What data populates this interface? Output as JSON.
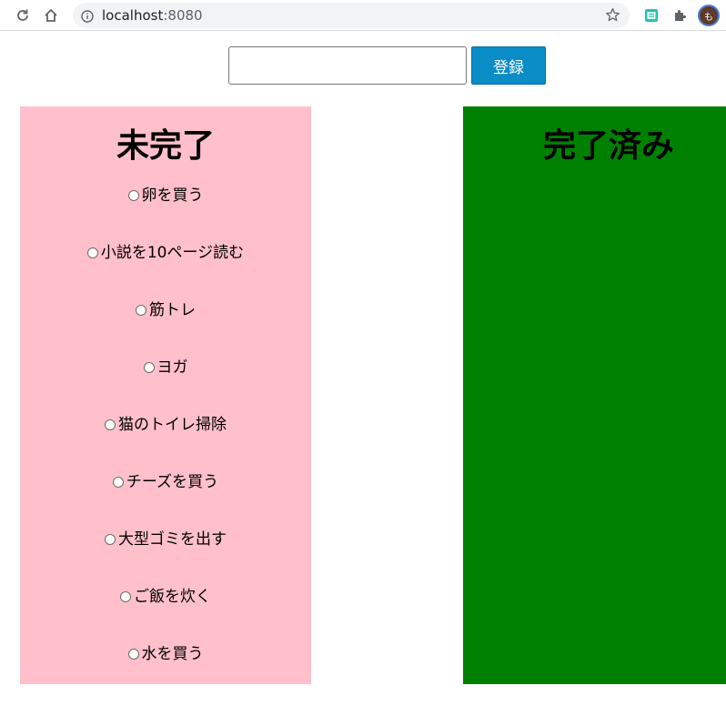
{
  "browser": {
    "url_host": "localhost",
    "url_port": ":8080",
    "avatar_initial": "も"
  },
  "form": {
    "input_value": "",
    "input_placeholder": "",
    "submit_label": "登録"
  },
  "incomplete": {
    "title": "未完了",
    "items": [
      {
        "label": "卵を買う"
      },
      {
        "label": "小説を10ページ読む"
      },
      {
        "label": "筋トレ"
      },
      {
        "label": "ヨガ"
      },
      {
        "label": "猫のトイレ掃除"
      },
      {
        "label": "チーズを買う"
      },
      {
        "label": "大型ゴミを出す"
      },
      {
        "label": "ご飯を炊く"
      },
      {
        "label": "水を買う"
      }
    ]
  },
  "complete": {
    "title": "完了済み",
    "items": []
  },
  "colors": {
    "incomplete_bg": "#ffc0cb",
    "complete_bg": "#008000",
    "button_bg": "#0a8cc7"
  }
}
